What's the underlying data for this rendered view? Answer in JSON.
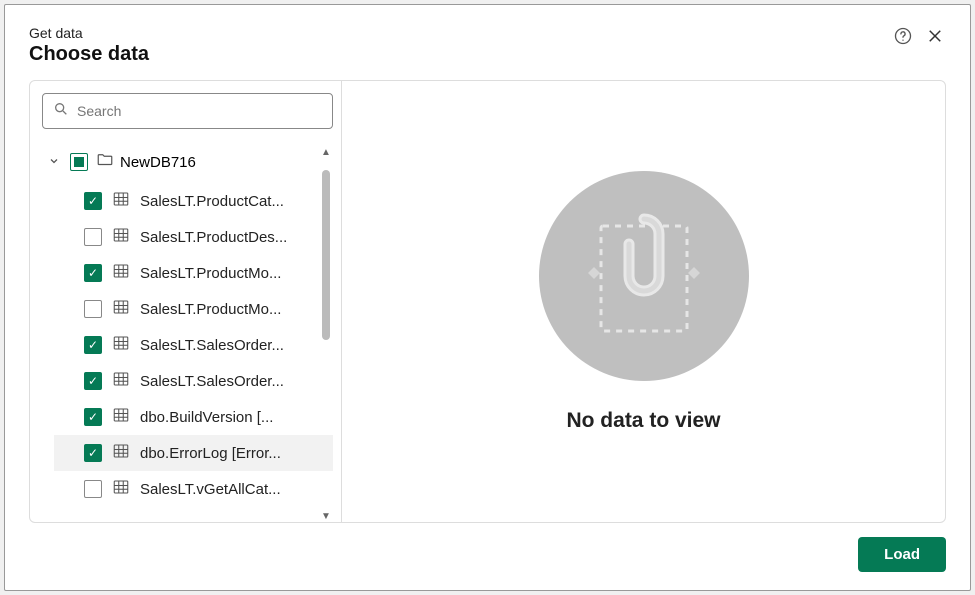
{
  "header": {
    "small": "Get data",
    "big": "Choose data"
  },
  "search": {
    "placeholder": "Search"
  },
  "database": {
    "name": "NewDB716",
    "state": "indeterminate"
  },
  "tables": [
    {
      "label": "SalesLT.ProductCat...",
      "checked": true,
      "hl": false
    },
    {
      "label": "SalesLT.ProductDes...",
      "checked": false,
      "hl": false
    },
    {
      "label": "SalesLT.ProductMo...",
      "checked": true,
      "hl": false
    },
    {
      "label": "SalesLT.ProductMo...",
      "checked": false,
      "hl": false
    },
    {
      "label": "SalesLT.SalesOrder...",
      "checked": true,
      "hl": false
    },
    {
      "label": "SalesLT.SalesOrder...",
      "checked": true,
      "hl": false
    },
    {
      "label": "dbo.BuildVersion [...",
      "checked": true,
      "hl": false
    },
    {
      "label": "dbo.ErrorLog [Error...",
      "checked": true,
      "hl": true
    },
    {
      "label": "SalesLT.vGetAllCat...",
      "checked": false,
      "hl": false
    }
  ],
  "placeholder": {
    "text": "No data to view"
  },
  "footer": {
    "load": "Load"
  }
}
